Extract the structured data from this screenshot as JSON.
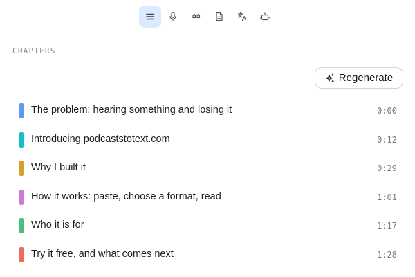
{
  "toolbar": {
    "buttons": [
      {
        "icon": "menu-lines-icon",
        "active": true
      },
      {
        "icon": "microphone-icon",
        "active": false
      },
      {
        "icon": "quote-icon",
        "active": false
      },
      {
        "icon": "document-icon",
        "active": false
      },
      {
        "icon": "translate-icon",
        "active": false
      },
      {
        "icon": "robot-icon",
        "active": false
      }
    ],
    "active_color": "#dbeafe",
    "icon_color": "#52525b"
  },
  "chapters": {
    "heading": "CHAPTERS",
    "regenerate_label": "Regenerate",
    "items": [
      {
        "title": "The problem: hearing something and losing it",
        "time": "0:00",
        "color": "#5b9cf0"
      },
      {
        "title": "Introducing podcaststotext.com",
        "time": "0:12",
        "color": "#14bfc9"
      },
      {
        "title": "Why I built it",
        "time": "0:29",
        "color": "#d6a02c"
      },
      {
        "title": "How it works: paste, choose a format, read",
        "time": "1:01",
        "color": "#cf7ad6"
      },
      {
        "title": "Who it is for",
        "time": "1:17",
        "color": "#4cbd7a"
      },
      {
        "title": "Try it free, and what comes next",
        "time": "1:28",
        "color": "#ee6b5e"
      }
    ]
  }
}
